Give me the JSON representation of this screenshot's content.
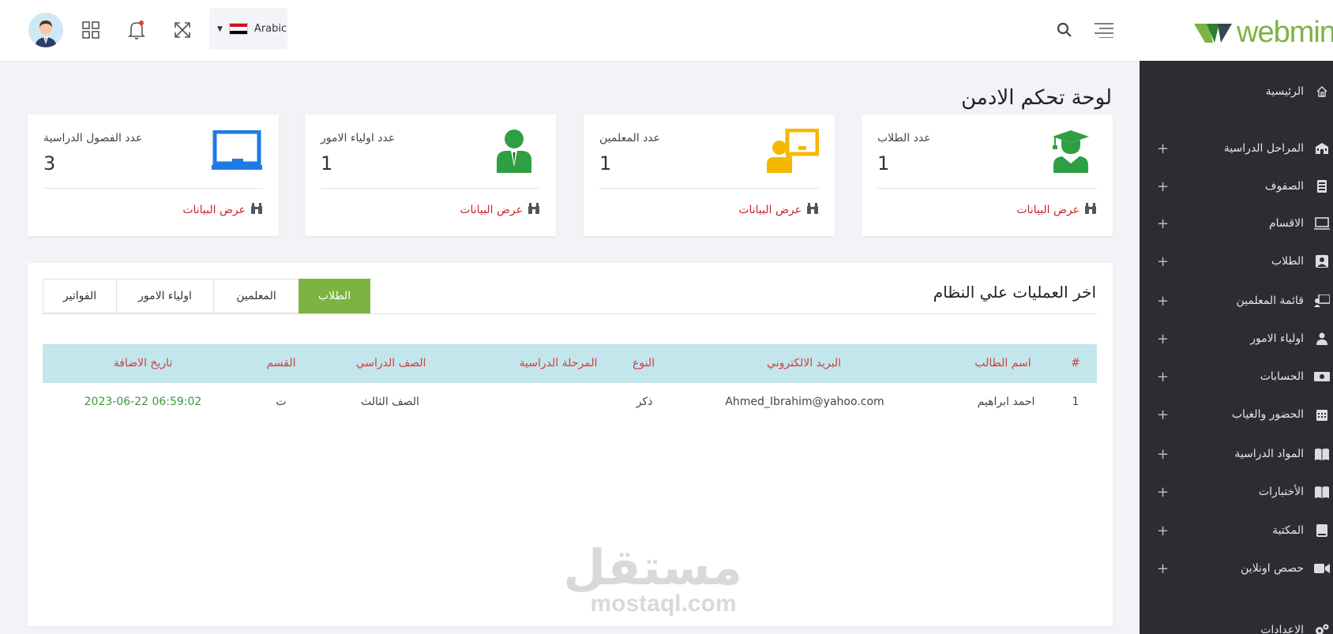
{
  "header": {
    "language": "Arabic",
    "logo_text": "webmin",
    "logo_color": "#7cb342"
  },
  "sidebar": {
    "items": [
      {
        "label": "الرئيسية",
        "icon": "home-icon",
        "expandable": false
      },
      {
        "label": "المراحل الدراسية",
        "icon": "school-icon",
        "expandable": true
      },
      {
        "label": "الصفوف",
        "icon": "classroom-icon",
        "expandable": true
      },
      {
        "label": "الاقسام",
        "icon": "monitor-icon",
        "expandable": true
      },
      {
        "label": "الطلاب",
        "icon": "student-icon",
        "expandable": true
      },
      {
        "label": "قائمة المعلمين",
        "icon": "teacher-icon",
        "expandable": true
      },
      {
        "label": "اولياء الامور",
        "icon": "parent-icon",
        "expandable": true
      },
      {
        "label": "الحسابات",
        "icon": "money-icon",
        "expandable": true
      },
      {
        "label": "الحضور والغياب",
        "icon": "calendar-icon",
        "expandable": true
      },
      {
        "label": "المواد الدراسية",
        "icon": "book-icon",
        "expandable": true
      },
      {
        "label": "الأختبارات",
        "icon": "book-open-icon",
        "expandable": true
      },
      {
        "label": "المكتبة",
        "icon": "library-icon",
        "expandable": true
      },
      {
        "label": "حصص اونلاين",
        "icon": "video-icon",
        "expandable": true
      },
      {
        "label": "الاعدادات",
        "icon": "gears-icon",
        "expandable": false
      }
    ],
    "plus_symbol": "+"
  },
  "page_title": "لوحة تحكم الادمن",
  "stats": [
    {
      "label": "عدد الفصول الدراسية",
      "value": "3",
      "link": "عرض البيانات",
      "icon": "chalkboard-icon",
      "color": "#1e7be6"
    },
    {
      "label": "عدد اولياء الامور",
      "value": "1",
      "link": "عرض البيانات",
      "icon": "parent-icon",
      "color": "#2ea043"
    },
    {
      "label": "عدد المعلمين",
      "value": "1",
      "link": "عرض البيانات",
      "icon": "teacher-icon",
      "color": "#f5b800"
    },
    {
      "label": "عدد الطلاب",
      "value": "1",
      "link": "عرض البيانات",
      "icon": "graduate-icon",
      "color": "#2ea043"
    }
  ],
  "operations": {
    "title": "اخر العمليات علي النظام",
    "tabs": [
      {
        "label": "الفواتير",
        "active": false
      },
      {
        "label": "اولياء الامور",
        "active": false
      },
      {
        "label": "المعلمين",
        "active": false
      },
      {
        "label": "الطلاب",
        "active": true
      }
    ],
    "columns": [
      "#",
      "اسم الطالب",
      "البريد الالكتروني",
      "النوع",
      "المرحلة الدراسية",
      "الصف الدراسي",
      "القسم",
      "تاريخ الاضافة"
    ],
    "rows": [
      {
        "index": "1",
        "name": "احمد ابراهيم",
        "email": "Ahmed_Ibrahim@yahoo.com",
        "gender": "ذكر",
        "stage": "",
        "grade": "الصف الثالث",
        "section": "ت",
        "date": "2023-06-22 06:59:02"
      }
    ]
  },
  "watermark": {
    "arabic": "مستقل",
    "latin": "mostaql.com"
  },
  "colors": {
    "accent": "#7cb342",
    "sidebar_bg": "#2b2d33",
    "link_red": "#c62828",
    "table_header_bg": "#c3e5ec",
    "date_green": "#3a9a3a"
  }
}
